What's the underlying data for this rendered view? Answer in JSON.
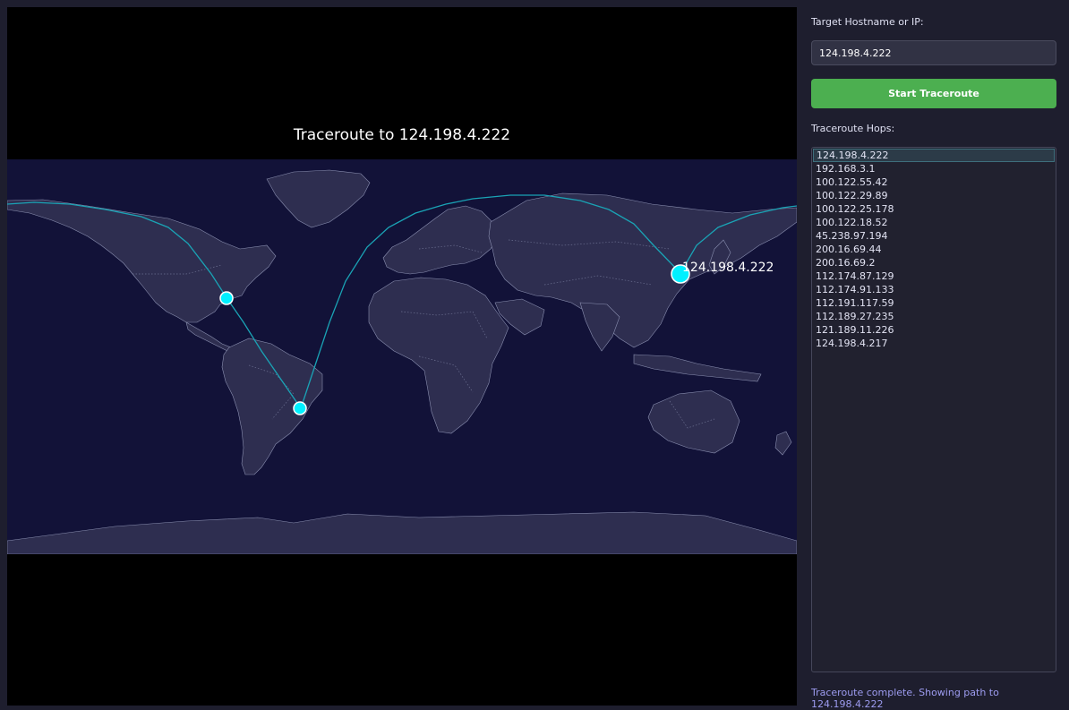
{
  "map": {
    "title": "Traceroute to 124.198.4.222",
    "destination_label": "124.198.4.222",
    "colors": {
      "ocean": "#121238",
      "land": "#2e2e50",
      "coast": "#8a8fb0",
      "route": "#1aa3b5",
      "marker": "#00f0ff"
    }
  },
  "sidebar": {
    "target_label": "Target Hostname or IP:",
    "target_value": "124.198.4.222",
    "start_button_label": "Start Traceroute",
    "hops_label": "Traceroute Hops:",
    "hops": [
      "124.198.4.222",
      "192.168.3.1",
      "100.122.55.42",
      "100.122.29.89",
      "100.122.25.178",
      "100.122.18.52",
      "45.238.97.194",
      "200.16.69.44",
      "200.16.69.2",
      "112.174.87.129",
      "112.174.91.133",
      "112.191.117.59",
      "112.189.27.235",
      "121.189.11.226",
      "124.198.4.217"
    ],
    "selected_hop_index": 0,
    "status_text": "Traceroute complete. Showing path to 124.198.4.222"
  }
}
